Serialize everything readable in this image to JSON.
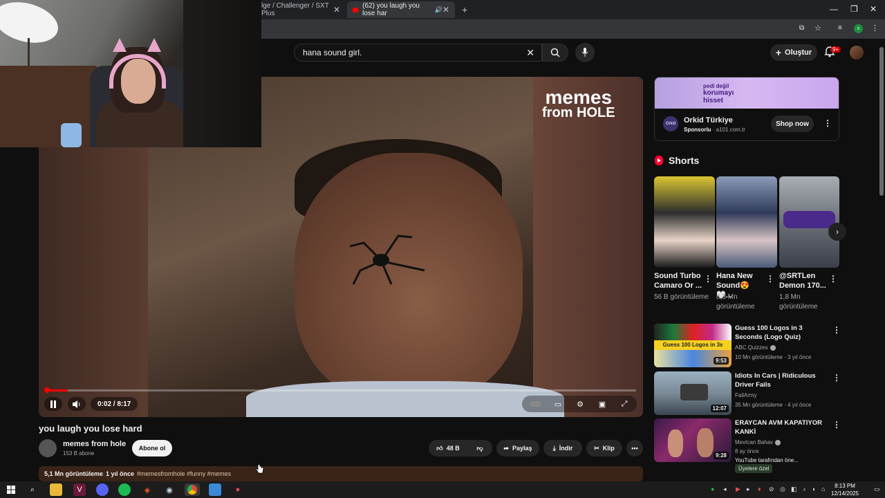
{
  "browser": {
    "tabs": [
      {
        "label": "lge / Challenger / SXT Plus"
      },
      {
        "label": "(62) you laugh you lose har"
      }
    ],
    "new_tab": "+"
  },
  "header": {
    "search_value": "hana sound girl.",
    "create_label": "Oluştur",
    "notif_count": "9+"
  },
  "player": {
    "watermark_line1": "memes",
    "watermark_line2": "from HOLE",
    "time": "0:02 / 8:17",
    "progress": 0.004
  },
  "video": {
    "title": "you laugh you lose hard",
    "channel": "memes from hole",
    "subs": "153 B abone",
    "subscribe": "Abone ol",
    "likes": "48 B",
    "share": "Paylaş",
    "download": "İndir",
    "clip": "Klip",
    "views": "5,1 Mn görüntüleme",
    "age": "1 yıl önce",
    "tags": "#memesfromhole #funny #memes"
  },
  "ad": {
    "banner_line1": "pedi değil",
    "banner_line2": "korumayı",
    "banner_line3": "hisset",
    "name": "Orkid Türkiye",
    "logo": "Orkid",
    "sponsored": "Sponsorlu",
    "domain": " · a101.com.tr",
    "cta": "Shop now"
  },
  "shorts": {
    "title": "Shorts",
    "items": [
      {
        "title": "Sound Turbo Camaro Or ...",
        "views": "56 B görüntüleme"
      },
      {
        "title": "Hana New Sound😍🤍...",
        "views": "8,3 Mn görüntüleme"
      },
      {
        "title": "@SRTLen Demon 170...",
        "views": "1,8 Mn görüntüleme"
      }
    ]
  },
  "recommendations": [
    {
      "title": "Guess 100 Logos in 3 Seconds (Logo Quiz)",
      "channel": "ABC Quizzes",
      "meta": "10 Mn görüntüleme · 3 yıl önce",
      "duration": "9:53",
      "thumb_text": "Guess 100 Logos in 3s"
    },
    {
      "title": "Idiots In Cars | Ridiculous Driver Fails",
      "channel": "FailArmy",
      "meta": "35 Mn görüntüleme · 4 yıl önce",
      "duration": "12:07"
    },
    {
      "title": "ERAYCAN AVM KAPATIYOR KANKİ",
      "channel": "Mevtcan Bahav",
      "meta": "8 ay önce",
      "duration": "9:28",
      "extra": "YouTube tarafından öne...",
      "badge": "Üyelere özel"
    }
  ],
  "taskbar": {
    "time": "8:13 PM",
    "date": "12/14/2025"
  },
  "colors": {
    "bg": "#0f0f0f",
    "accent": "#ff0000",
    "desc_bg": "#3a2417"
  }
}
